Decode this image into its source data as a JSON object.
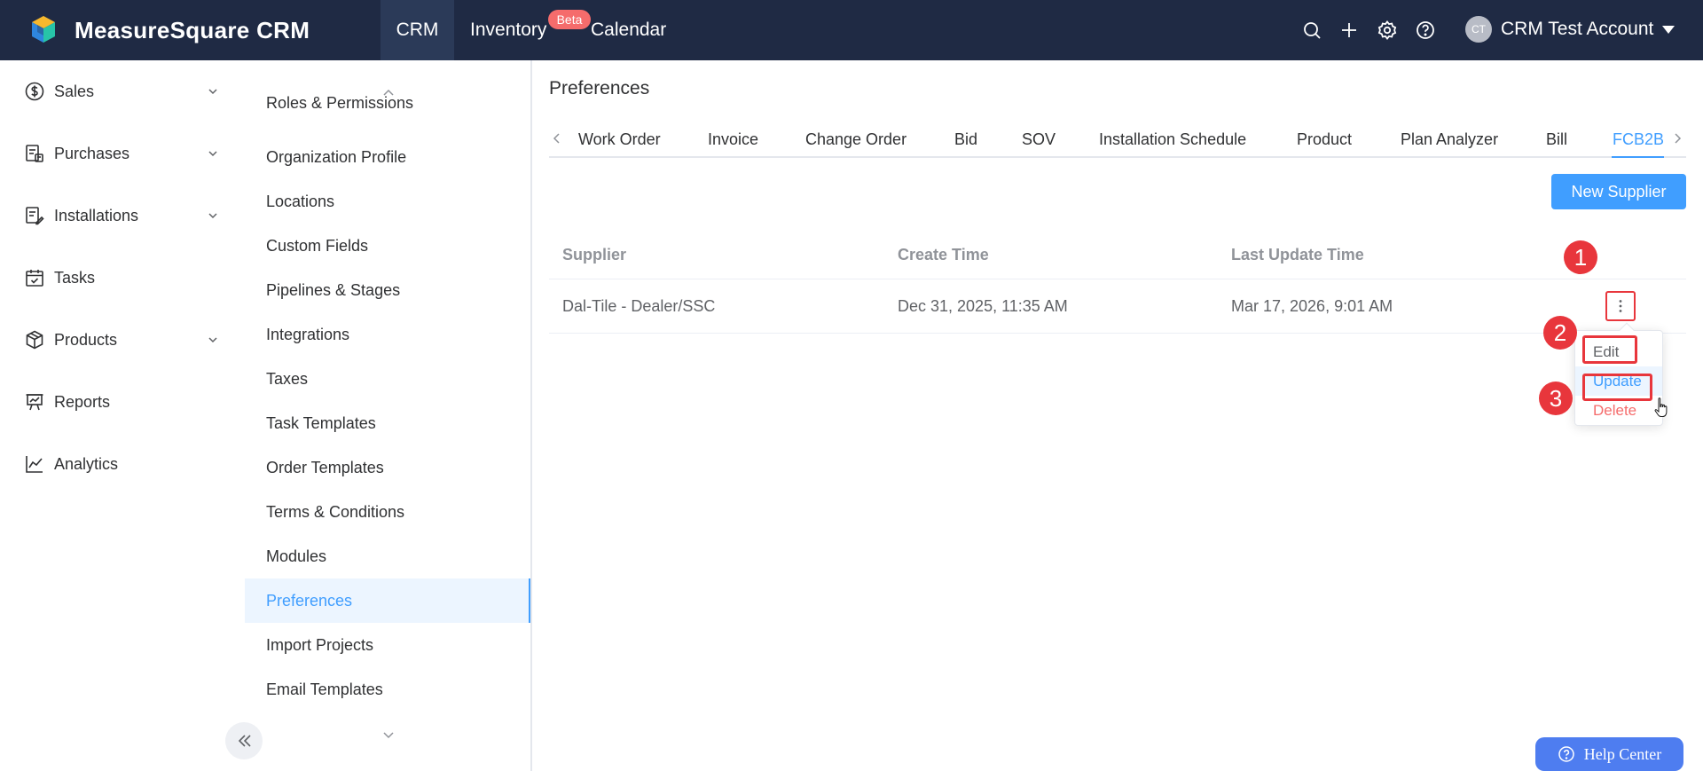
{
  "app": {
    "brand": "MeasureSquare CRM"
  },
  "topnav": {
    "items": [
      {
        "label": "CRM",
        "active": true
      },
      {
        "label": "Inventory",
        "badge": "Beta"
      },
      {
        "label": "Calendar"
      }
    ],
    "icons": [
      "search-icon",
      "plus-icon",
      "gear-icon",
      "help-icon"
    ],
    "account": {
      "initials": "CT",
      "name": "CRM Test Account"
    }
  },
  "sidebar": {
    "items": [
      {
        "label": "Sales",
        "icon": "dollar-icon",
        "expandable": true
      },
      {
        "label": "Purchases",
        "icon": "purchase-icon",
        "expandable": true
      },
      {
        "label": "Installations",
        "icon": "installation-icon",
        "expandable": true
      },
      {
        "label": "Tasks",
        "icon": "calendar-check-icon",
        "expandable": false
      },
      {
        "label": "Products",
        "icon": "box-icon",
        "expandable": true
      },
      {
        "label": "Reports",
        "icon": "presentation-icon",
        "expandable": false
      },
      {
        "label": "Analytics",
        "icon": "line-chart-icon",
        "expandable": false
      }
    ]
  },
  "submenu": {
    "items": [
      {
        "label": "Roles & Permissions"
      },
      {
        "label": "Organization Profile"
      },
      {
        "label": "Locations"
      },
      {
        "label": "Custom Fields"
      },
      {
        "label": "Pipelines & Stages"
      },
      {
        "label": "Integrations"
      },
      {
        "label": "Taxes"
      },
      {
        "label": "Task Templates"
      },
      {
        "label": "Order Templates"
      },
      {
        "label": "Terms & Conditions"
      },
      {
        "label": "Modules"
      },
      {
        "label": "Preferences",
        "active": true
      },
      {
        "label": "Import Projects"
      },
      {
        "label": "Email Templates"
      }
    ]
  },
  "main": {
    "title": "Preferences",
    "tabs": [
      {
        "label": "Work Order"
      },
      {
        "label": "Invoice"
      },
      {
        "label": "Change Order"
      },
      {
        "label": "Bid"
      },
      {
        "label": "SOV"
      },
      {
        "label": "Installation Schedule"
      },
      {
        "label": "Product"
      },
      {
        "label": "Plan Analyzer"
      },
      {
        "label": "Bill"
      },
      {
        "label": "FCB2B",
        "active": true
      }
    ],
    "new_button": "New Supplier",
    "table": {
      "columns": [
        "Supplier",
        "Create Time",
        "Last Update Time"
      ],
      "rows": [
        {
          "supplier": "Dal-Tile - Dealer/SSC",
          "create_time": "Dec 31, 2025, 11:35 AM",
          "last_update": "Mar 17, 2026, 9:01 AM"
        }
      ]
    },
    "row_menu": {
      "items": [
        {
          "label": "Edit"
        },
        {
          "label": "Update",
          "hover": true
        },
        {
          "label": "Delete",
          "danger": true
        }
      ]
    }
  },
  "annotations": {
    "steps": [
      "1",
      "2",
      "3"
    ],
    "color": "#e8363c"
  },
  "help": {
    "label": "Help Center"
  },
  "colors": {
    "topbar": "#1f2a44",
    "accent": "#409eff",
    "danger": "#f56c6c",
    "help": "#4e7df0"
  }
}
